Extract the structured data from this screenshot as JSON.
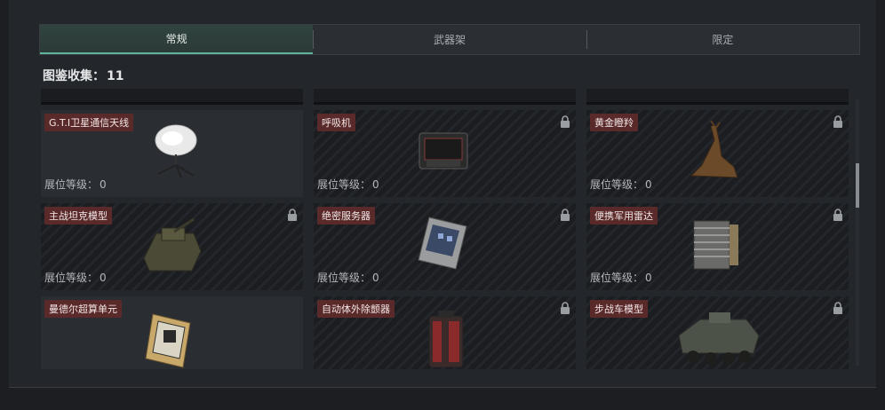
{
  "tabs": [
    {
      "label": "常规",
      "active": true
    },
    {
      "label": "武器架",
      "active": false
    },
    {
      "label": "限定",
      "active": false
    }
  ],
  "collection": {
    "label": "图鉴收集：",
    "count": "11"
  },
  "level_label": "展位等级：",
  "cards": [
    {
      "name": "G.T.I卫星通信天线",
      "level": "0",
      "locked": false,
      "icon": "satellite-dish-icon"
    },
    {
      "name": "呼吸机",
      "level": "0",
      "locked": true,
      "icon": "respirator-icon"
    },
    {
      "name": "黄金瞪羚",
      "level": "0",
      "locked": true,
      "icon": "golden-gazelle-icon"
    },
    {
      "name": "主战坦克模型",
      "level": "0",
      "locked": true,
      "icon": "tank-model-icon"
    },
    {
      "name": "绝密服务器",
      "level": "0",
      "locked": true,
      "icon": "server-icon"
    },
    {
      "name": "便携军用雷达",
      "level": "0",
      "locked": true,
      "icon": "radar-icon"
    },
    {
      "name": "曼德尔超算单元",
      "level": "",
      "locked": false,
      "icon": "supercomputer-unit-icon"
    },
    {
      "name": "自动体外除颤器",
      "level": "",
      "locked": true,
      "icon": "defibrillator-icon"
    },
    {
      "name": "步战车模型",
      "level": "",
      "locked": true,
      "icon": "ifv-model-icon"
    }
  ]
}
